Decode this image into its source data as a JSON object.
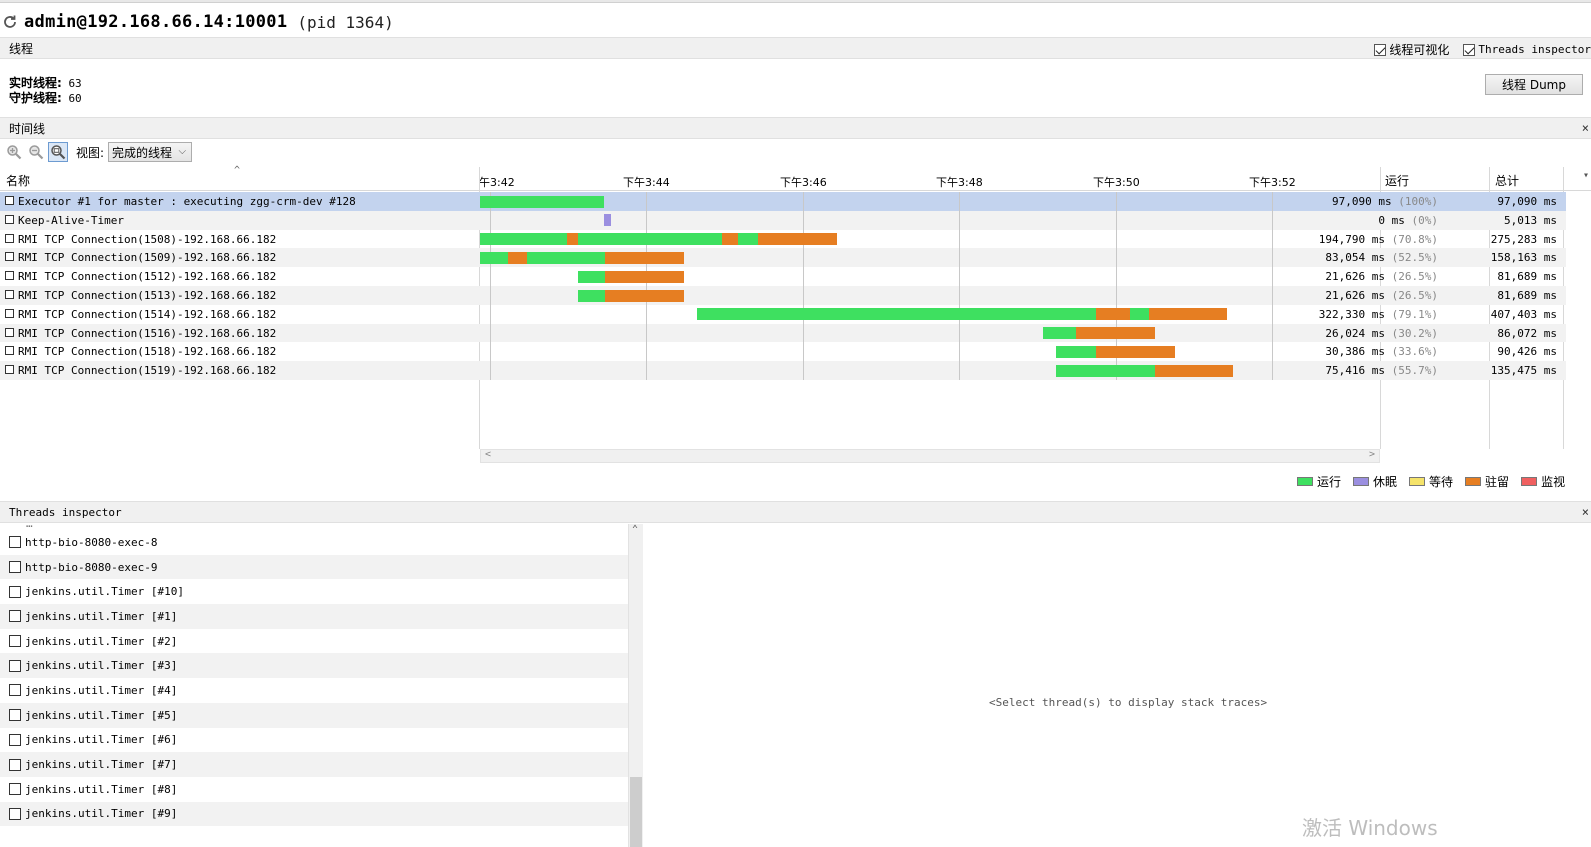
{
  "app": {
    "title": "admin@192.168.66.14:10001",
    "pid": "(pid 1364)"
  },
  "threads_section": {
    "title": "线程",
    "checkbox_visualize": "线程可视化",
    "checkbox_inspector": "Threads inspector",
    "live_label": "实时线程:",
    "live_value": "63",
    "daemon_label": "守护线程:",
    "daemon_value": "60",
    "dump_button": "线程 Dump"
  },
  "timeline": {
    "title": "时间线",
    "close": "×",
    "view_label": "视图:",
    "view_value": "完成的线程",
    "col_name": "名称",
    "col_run": "运行",
    "col_total": "总计",
    "ticks": [
      "午3:42",
      "下午3:44",
      "下午3:46",
      "下午3:48",
      "下午3:50",
      "下午3:52"
    ]
  },
  "thread_rows": [
    {
      "name": "Executor #1 for master : executing zgg-crm-dev #128",
      "run": "97,090 ms",
      "pct": "(100%)",
      "total": "97,090 ms"
    },
    {
      "name": "Keep-Alive-Timer",
      "run": "0 ms",
      "pct": "(0%)",
      "total": "5,013 ms"
    },
    {
      "name": "RMI TCP Connection(1508)-192.168.66.182",
      "run": "194,790 ms",
      "pct": "(70.8%)",
      "total": "275,283 ms"
    },
    {
      "name": "RMI TCP Connection(1509)-192.168.66.182",
      "run": "83,054 ms",
      "pct": "(52.5%)",
      "total": "158,163 ms"
    },
    {
      "name": "RMI TCP Connection(1512)-192.168.66.182",
      "run": "21,626 ms",
      "pct": "(26.5%)",
      "total": "81,689 ms"
    },
    {
      "name": "RMI TCP Connection(1513)-192.168.66.182",
      "run": "21,626 ms",
      "pct": "(26.5%)",
      "total": "81,689 ms"
    },
    {
      "name": "RMI TCP Connection(1514)-192.168.66.182",
      "run": "322,330 ms",
      "pct": "(79.1%)",
      "total": "407,403 ms"
    },
    {
      "name": "RMI TCP Connection(1516)-192.168.66.182",
      "run": "26,024 ms",
      "pct": "(30.2%)",
      "total": "86,072 ms"
    },
    {
      "name": "RMI TCP Connection(1518)-192.168.66.182",
      "run": "30,386 ms",
      "pct": "(33.6%)",
      "total": "90,426 ms"
    },
    {
      "name": "RMI TCP Connection(1519)-192.168.66.182",
      "run": "75,416 ms",
      "pct": "(55.7%)",
      "total": "135,475 ms"
    }
  ],
  "legend": [
    {
      "label": "运行",
      "color": "#3ee060"
    },
    {
      "label": "休眠",
      "color": "#9b8fe0"
    },
    {
      "label": "等待",
      "color": "#f5e36a"
    },
    {
      "label": "驻留",
      "color": "#e67e22"
    },
    {
      "label": "监视",
      "color": "#f06060"
    }
  ],
  "inspector": {
    "title": "Threads inspector",
    "close": "×",
    "placeholder": "<Select thread(s) to display stack traces>",
    "items": [
      "http-bio-8080-exec-8",
      "http-bio-8080-exec-9",
      "jenkins.util.Timer [#10]",
      "jenkins.util.Timer [#1]",
      "jenkins.util.Timer [#2]",
      "jenkins.util.Timer [#3]",
      "jenkins.util.Timer [#4]",
      "jenkins.util.Timer [#5]",
      "jenkins.util.Timer [#6]",
      "jenkins.util.Timer [#7]",
      "jenkins.util.Timer [#8]",
      "jenkins.util.Timer [#9]"
    ]
  },
  "watermark": "激活 Windows"
}
